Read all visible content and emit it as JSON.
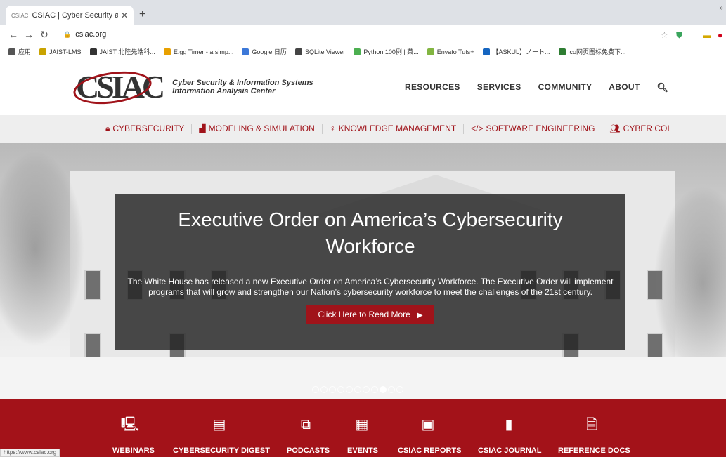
{
  "browser": {
    "tab_title": "CSIAC | Cyber Security and Info",
    "tab_favicon": "CSIAC",
    "new_tab": "+",
    "url": "csiac.org",
    "status_url": "https://www.csiac.org"
  },
  "bookmarks": [
    {
      "label": "应用",
      "icon": "apps-icon",
      "color": "#555"
    },
    {
      "label": "JAIST-LMS",
      "icon": "jaist-icon",
      "color": "#c9a300"
    },
    {
      "label": "JAIST 北陸先端科...",
      "icon": "jaist2-icon",
      "color": "#333"
    },
    {
      "label": "E.gg Timer - a simp...",
      "icon": "egg-icon",
      "color": "#e8a000"
    },
    {
      "label": "Google 日历",
      "icon": "calendar-icon",
      "color": "#3c78d8"
    },
    {
      "label": "SQLite Viewer",
      "icon": "sqlite-icon",
      "color": "#444"
    },
    {
      "label": "Python 100例 | 菜...",
      "icon": "python-icon",
      "color": "#4caf50"
    },
    {
      "label": "Envato Tuts+",
      "icon": "envato-icon",
      "color": "#82b541"
    },
    {
      "label": "【ASKUL】ノート...",
      "icon": "askul-icon",
      "color": "#1565c0"
    },
    {
      "label": "ico网页图标免费下...",
      "icon": "ico-icon",
      "color": "#2e7d32"
    }
  ],
  "site": {
    "logo_mark": "CSIAC",
    "logo_line1": "Cyber Security & Information Systems",
    "logo_line2": "Information Analysis Center",
    "main_nav": [
      "RESOURCES",
      "SERVICES",
      "COMMUNITY",
      "ABOUT"
    ],
    "topics": [
      {
        "label": "CYBERSECURITY",
        "icon": "lock-icon"
      },
      {
        "label": "MODELING & SIMULATION",
        "icon": "chart-icon"
      },
      {
        "label": "KNOWLEDGE MANAGEMENT",
        "icon": "lightbulb-icon"
      },
      {
        "label": "SOFTWARE ENGINEERING",
        "icon": "code-icon"
      },
      {
        "label": "CYBER COI",
        "icon": "group-icon"
      }
    ]
  },
  "hero": {
    "title": "Executive Order on America’s Cybersecurity Workforce",
    "description": "The White House has released a new Executive Order on America’s Cybersecurity Workforce. The Executive Order will implement programs that will grow and strengthen our Nation’s cybersecurity workforce to meet the challenges of the 21st century.",
    "button": "Click Here to Read More",
    "slide_count": 11,
    "active_slide": 8
  },
  "features": [
    {
      "label": "WEBINARS",
      "icon": "monitor-icon"
    },
    {
      "label": "CYBERSECURITY DIGEST",
      "icon": "digest-icon"
    },
    {
      "label": "PODCASTS",
      "icon": "podcast-icon"
    },
    {
      "label": "EVENTS",
      "icon": "calendar-icon"
    },
    {
      "label": "CSIAC REPORTS",
      "icon": "report-icon"
    },
    {
      "label": "CSIAC JOURNAL",
      "icon": "book-icon"
    },
    {
      "label": "REFERENCE DOCS",
      "icon": "document-icon"
    }
  ],
  "colors": {
    "brand": "#a31219"
  }
}
